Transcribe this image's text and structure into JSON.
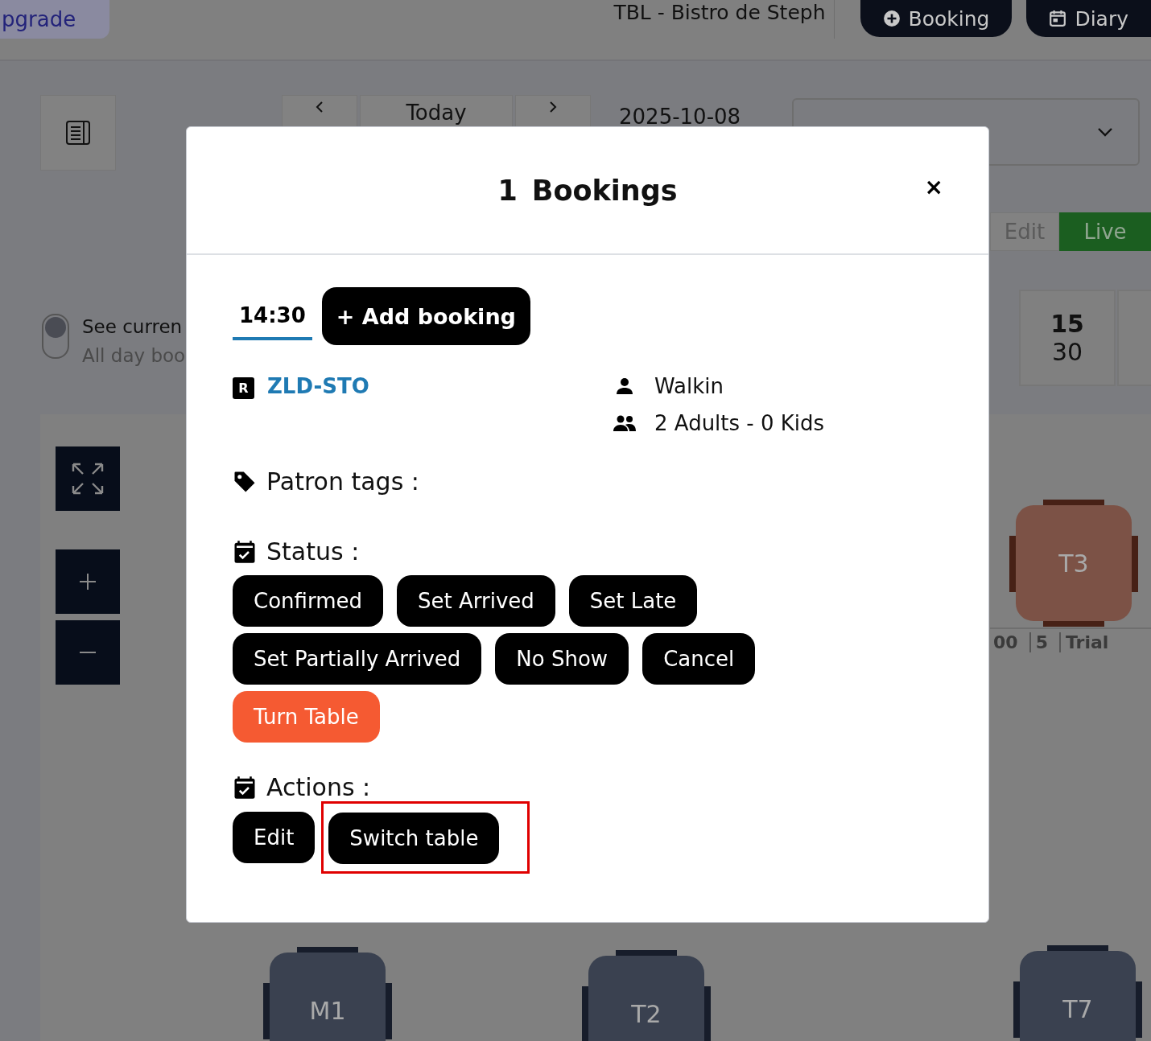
{
  "top_bar": {
    "upgrade_label": "pgrade",
    "venue": "TBL - Bistro de Steph",
    "buttons": [
      {
        "label": "Booking"
      },
      {
        "label": "Diary"
      }
    ]
  },
  "date_nav": {
    "today": "Today",
    "date": "2025-10-08"
  },
  "view_tabs": [
    {
      "label": "Edit",
      "selected": false
    },
    {
      "label": "Live",
      "selected": true
    }
  ],
  "toggle": {
    "on": false,
    "label": "See curren",
    "sublabel": "All day boo"
  },
  "time_slots": [
    {
      "hour": "15",
      "minute": "30"
    }
  ],
  "floor": {
    "tables": [
      {
        "name": "T3",
        "color": "#7c5246",
        "info": [
          "00",
          "5",
          "Trial"
        ]
      },
      {
        "name": "M1",
        "color": "#3a4150"
      },
      {
        "name": "T2",
        "color": "#3a4150"
      },
      {
        "name": "T7",
        "color": "#3a4150"
      }
    ]
  },
  "modal": {
    "count": "1",
    "title": "Bookings",
    "close": "×",
    "time_tabs": [
      {
        "label": "14:30",
        "selected": true
      }
    ],
    "add_booking": "+ Add booking",
    "reference_badge": "R",
    "reference": "ZLD-STO",
    "guest": "Walkin",
    "party": "2 Adults - 0 Kids",
    "patron_tags_label": "Patron tags :",
    "status_label": "Status :",
    "status_buttons": [
      {
        "label": "Confirmed",
        "kind": "default"
      },
      {
        "label": "Set Arrived",
        "kind": "default"
      },
      {
        "label": "Set Late",
        "kind": "default"
      },
      {
        "label": "Set Partially Arrived",
        "kind": "default"
      },
      {
        "label": "No Show",
        "kind": "default"
      },
      {
        "label": "Cancel",
        "kind": "default"
      },
      {
        "label": "Turn Table",
        "kind": "accent"
      }
    ],
    "actions_label": "Actions :",
    "action_buttons": [
      {
        "label": "Edit",
        "highlighted": false
      },
      {
        "label": "Switch table",
        "highlighted": true
      }
    ]
  }
}
